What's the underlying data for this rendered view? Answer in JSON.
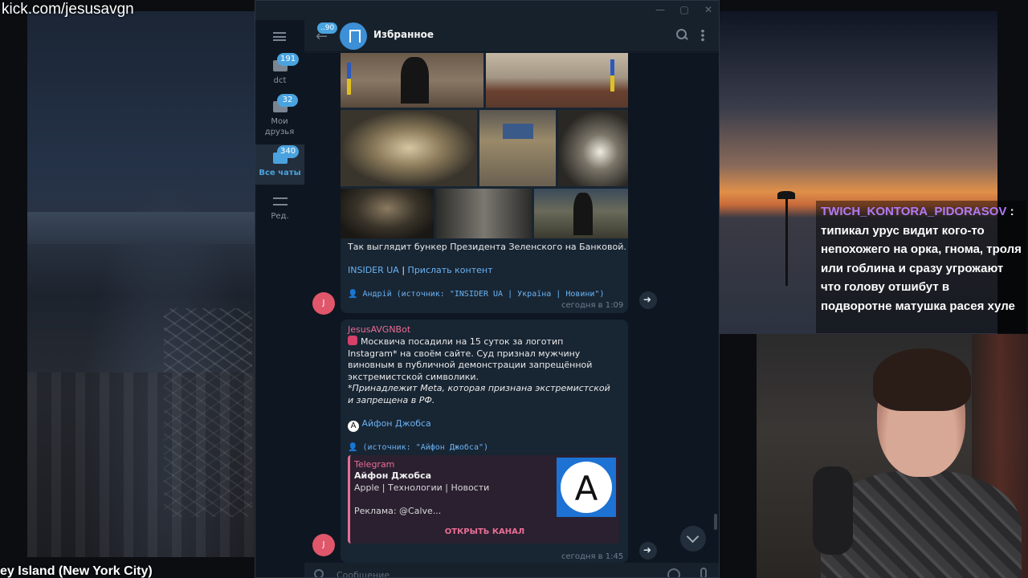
{
  "stream": {
    "url": "kick.com/jesusavgn",
    "caption": "ey Island (New York City)"
  },
  "twitch_chat": {
    "username": "TWICH_KONTORA_PIDORASOV",
    "separator": " :",
    "message": "типикал урус видит кого-то непохожего на орка, гнома, троля или гоблина и сразу угрожают что голову отшибут в подворотне матушка расея хуле"
  },
  "window": {
    "controls": [
      "—",
      "▢",
      "✕"
    ]
  },
  "sidebar": {
    "folders": [
      {
        "label": "dct",
        "badge": "191",
        "icon": "folder-icon"
      },
      {
        "label": "Мои друзья",
        "badge": "32",
        "icon": "folder-icon"
      },
      {
        "label": "Все чаты",
        "badge": "340",
        "icon": "chats-icon",
        "active": true
      },
      {
        "label": "Ред.",
        "badge": "",
        "icon": "sliders-icon"
      }
    ]
  },
  "header": {
    "back_badge": "..90",
    "title": "Избранное"
  },
  "messages": [
    {
      "caption": "Так выглядит бункер Президента Зеленского на Банковой.",
      "links": [
        "INSIDER UA",
        " | ",
        "Прислать контент"
      ],
      "source_line": "👤 Андрій (источник: \"INSIDER UA | Україна | Новини\")",
      "time": "сегодня в 1:09",
      "avatar": "J"
    },
    {
      "sender": "JesusAVGNBot",
      "text1": "Москвича посадили на 15 суток за логотип Instagram* на своём сайте. Суд признал мужчину виновным в публичной демонстрации запрещённой экстремистской символики.",
      "text2": "*Принадлежит Meta, которая признана экстремистской и запрещена в РФ.",
      "channel_link": "Айфон Джобса",
      "source_line": "👤   (источник: \"Айфон Джобса\")",
      "preview": {
        "source": "Telegram",
        "title": "Айфон Джобса",
        "desc1": "Apple | Технологии | Новости",
        "desc2": "Реклама: @Calve...",
        "button": "ОТКРЫТЬ КАНАЛ",
        "logo_letter": "A"
      },
      "time": "сегодня в 1:45",
      "avatar": "J"
    }
  ],
  "composer": {
    "placeholder": "Сообщение"
  }
}
